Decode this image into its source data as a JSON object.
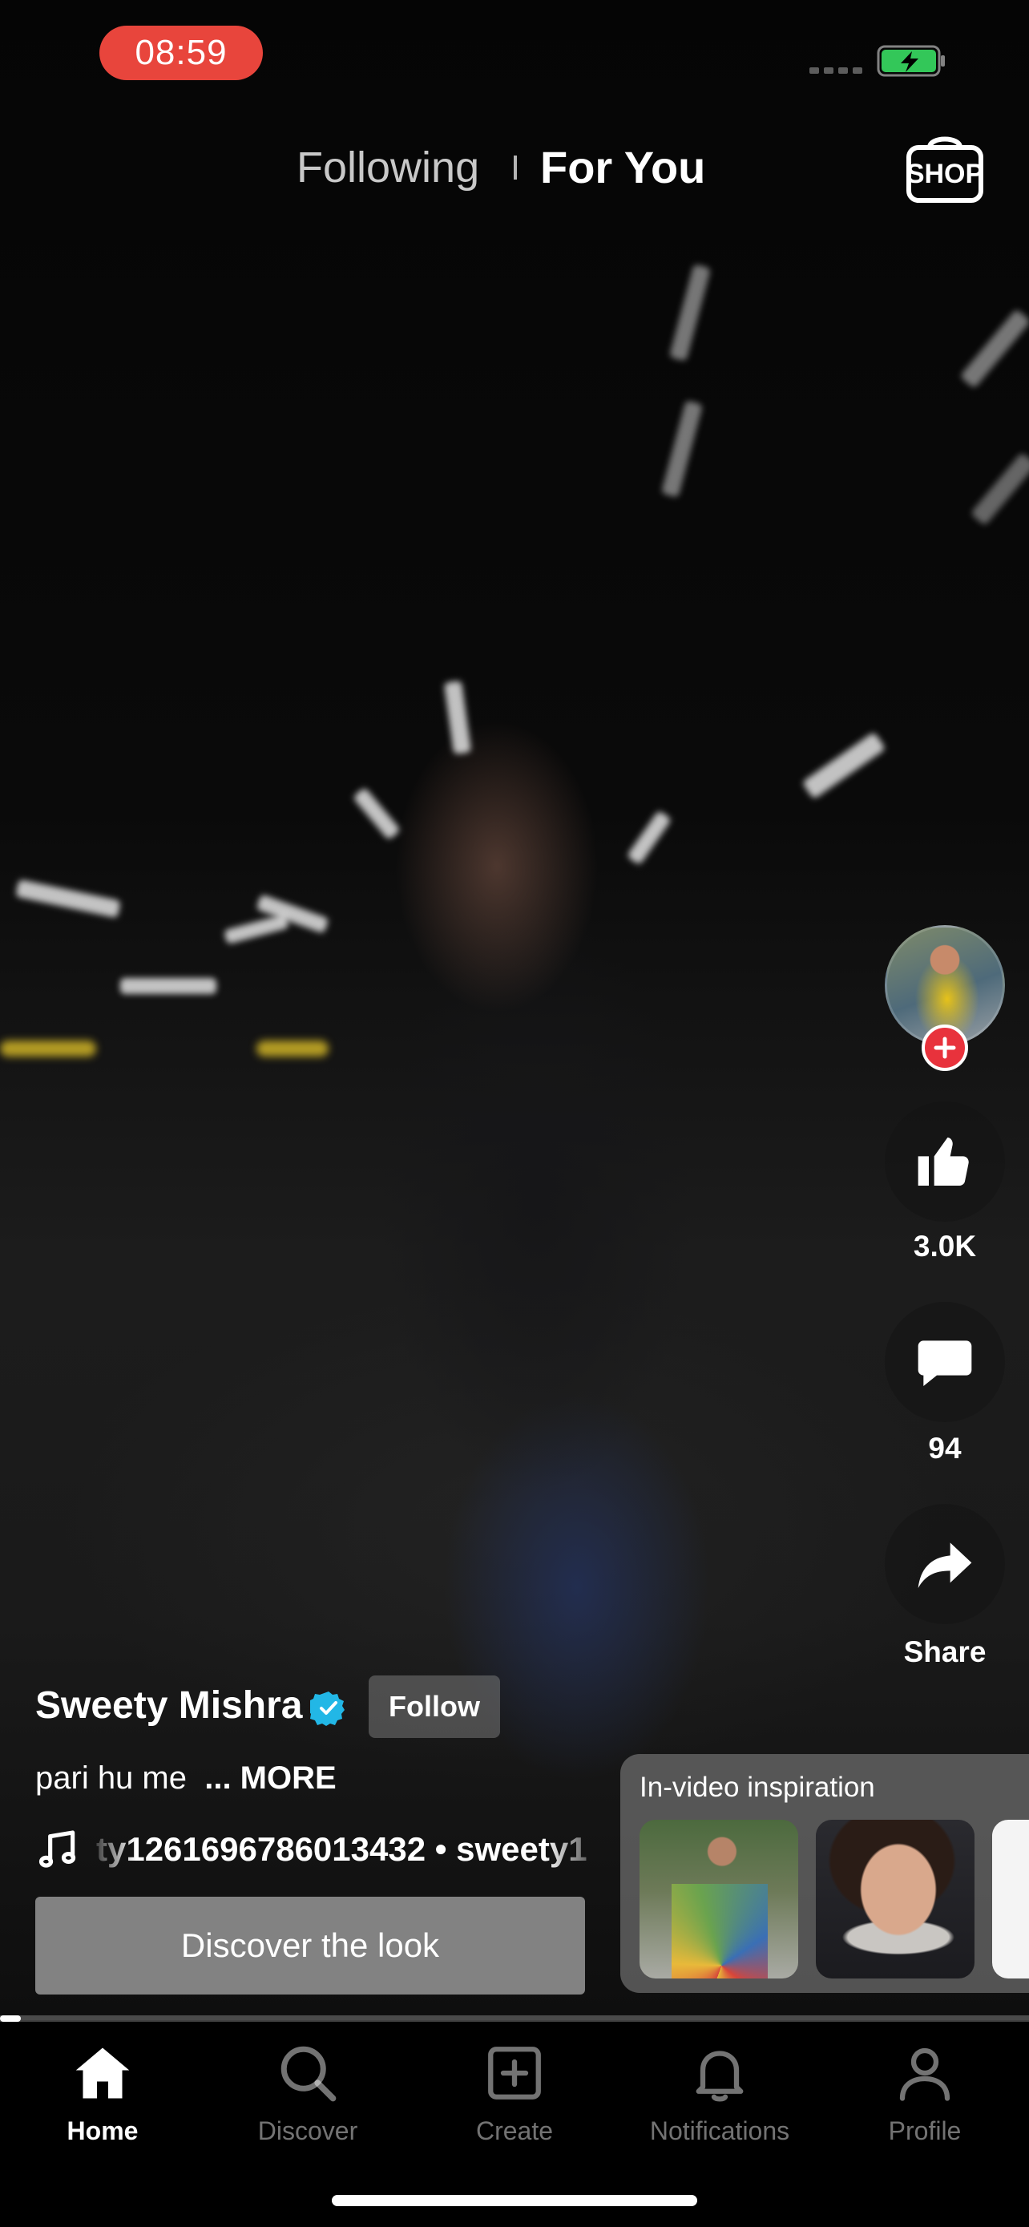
{
  "status_bar": {
    "time": "08:59",
    "battery_icon": "battery-charging-icon"
  },
  "top_tabs": {
    "following": "Following",
    "for_you": "For You",
    "active": "For You",
    "shop_icon": "shop-bag-icon"
  },
  "shop_label": "SHOP",
  "actions": {
    "avatar_icon": "creator-avatar",
    "likes": "3.0K",
    "comments": "94",
    "share": "Share"
  },
  "post": {
    "username": "Sweety Mishra",
    "verified": true,
    "follow_label": "Follow",
    "caption": "pari hu me",
    "more_label": "... MORE",
    "music_text": "ty1261696786013432 • sweety1",
    "discover_label": "Discover the look"
  },
  "inspiration": {
    "title": "In-video inspiration",
    "items": [
      "inspiration-thumb-1",
      "inspiration-thumb-2",
      "inspiration-thumb-3"
    ]
  },
  "progress": {
    "fraction": 0.02
  },
  "tabbar": {
    "items": [
      {
        "label": "Home",
        "icon": "home-icon",
        "active": true
      },
      {
        "label": "Discover",
        "icon": "search-icon",
        "active": false
      },
      {
        "label": "Create",
        "icon": "plus-square-icon",
        "active": false
      },
      {
        "label": "Notifications",
        "icon": "bell-icon",
        "active": false
      },
      {
        "label": "Profile",
        "icon": "person-icon",
        "active": false
      }
    ]
  },
  "colors": {
    "accent_red": "#e8323c",
    "verified_blue": "#22b7e6",
    "battery_green": "#33c759"
  }
}
